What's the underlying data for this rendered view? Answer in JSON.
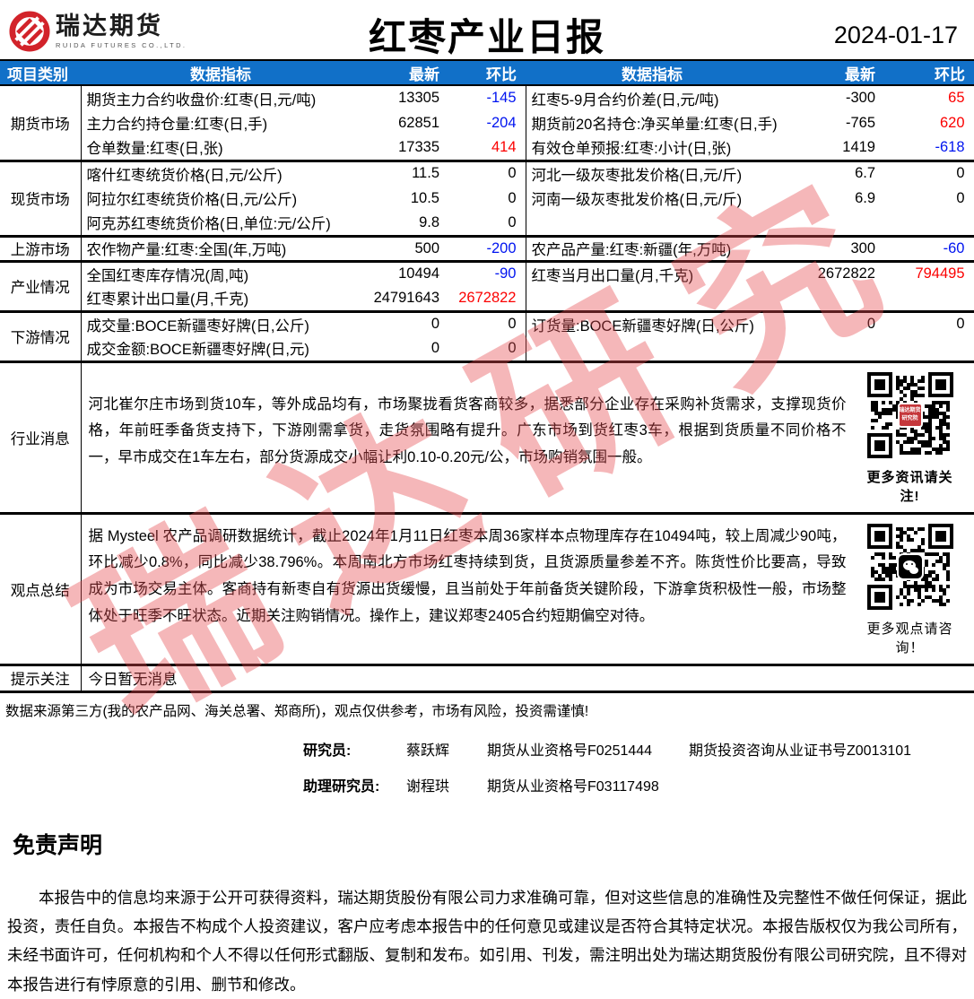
{
  "header": {
    "logo_cn": "瑞达期货",
    "logo_en": "RUIDA FUTURES CO.,LTD.",
    "title": "红枣产业日报",
    "date": "2024-01-17"
  },
  "colors": {
    "header_bg": "#1170c8",
    "up_red": "#fb0000",
    "down_blue": "#0014f0",
    "watermark_red": "#e74b4f",
    "logo_red": "#d2232a"
  },
  "watermark": "瑞达研究",
  "table": {
    "columns": [
      "项目类别",
      "数据指标",
      "最新",
      "环比",
      "数据指标",
      "最新",
      "环比"
    ],
    "sections": [
      {
        "category": "期货市场",
        "rows": [
          {
            "l_label": "期货主力合约收盘价:红枣(日,元/吨)",
            "l_latest": "13305",
            "l_delta": "-145",
            "l_trend": "down",
            "r_label": "红枣5-9月合约价差(日,元/吨)",
            "r_latest": "-300",
            "r_delta": "65",
            "r_trend": "up"
          },
          {
            "l_label": "主力合约持仓量:红枣(日,手)",
            "l_latest": "62851",
            "l_delta": "-204",
            "l_trend": "down",
            "r_label": "期货前20名持仓:净买单量:红枣(日,手)",
            "r_latest": "-765",
            "r_delta": "620",
            "r_trend": "up"
          },
          {
            "l_label": "仓单数量:红枣(日,张)",
            "l_latest": "17335",
            "l_delta": "414",
            "l_trend": "up",
            "r_label": "有效仓单预报:红枣:小计(日,张)",
            "r_latest": "1419",
            "r_delta": "-618",
            "r_trend": "down"
          }
        ]
      },
      {
        "category": "现货市场",
        "rows": [
          {
            "l_label": "喀什红枣统货价格(日,元/公斤)",
            "l_latest": "11.5",
            "l_delta": "0",
            "l_trend": "",
            "r_label": "河北一级灰枣批发价格(日,元/斤)",
            "r_latest": "6.7",
            "r_delta": "0",
            "r_trend": ""
          },
          {
            "l_label": "阿拉尔红枣统货价格(日,元/公斤)",
            "l_latest": "10.5",
            "l_delta": "0",
            "l_trend": "",
            "r_label": "河南一级灰枣批发价格(日,元/斤)",
            "r_latest": "6.9",
            "r_delta": "0",
            "r_trend": ""
          },
          {
            "l_label": "阿克苏红枣统货价格(日,单位:元/公斤)",
            "l_latest": "9.8",
            "l_delta": "0",
            "l_trend": "",
            "r_label": "",
            "r_latest": "",
            "r_delta": "",
            "r_trend": ""
          }
        ]
      },
      {
        "category": "上游市场",
        "rows": [
          {
            "l_label": "农作物产量:红枣:全国(年,万吨)",
            "l_latest": "500",
            "l_delta": "-200",
            "l_trend": "down",
            "r_label": "农产品产量:红枣:新疆(年,万吨)",
            "r_latest": "300",
            "r_delta": "-60",
            "r_trend": "down"
          }
        ]
      },
      {
        "category": "产业情况",
        "rows": [
          {
            "l_label": "全国红枣库存情况(周,吨)",
            "l_latest": "10494",
            "l_delta": "-90",
            "l_trend": "down",
            "r_label": "红枣当月出口量(月,千克)",
            "r_latest": "2672822",
            "r_delta": "794495",
            "r_trend": "up"
          },
          {
            "l_label": "红枣累计出口量(月,千克)",
            "l_latest": "24791643",
            "l_delta": "2672822",
            "l_trend": "up",
            "r_label": "",
            "r_latest": "",
            "r_delta": "",
            "r_trend": ""
          }
        ]
      },
      {
        "category": "下游情况",
        "rows": [
          {
            "l_label": "成交量:BOCE新疆枣好牌(日,公斤)",
            "l_latest": "0",
            "l_delta": "0",
            "l_trend": "",
            "r_label": "订货量:BOCE新疆枣好牌(日,公斤)",
            "r_latest": "0",
            "r_delta": "0",
            "r_trend": ""
          },
          {
            "l_label": "成交金额:BOCE新疆枣好牌(日,元)",
            "l_latest": "0",
            "l_delta": "0",
            "l_trend": "",
            "r_label": "",
            "r_latest": "",
            "r_delta": "",
            "r_trend": ""
          }
        ]
      }
    ],
    "news": {
      "category": "行业消息",
      "text": "河北崔尔庄市场到货10车，等外成品均有，市场聚拢看货客商较多，据悉部分企业存在采购补货需求，支撑现货价格，年前旺季备货支持下，下游刚需拿货，走货氛围略有提升。广东市场到货红枣3车，根据到货质量不同价格不一，早市成交在1车左右，部分货源成交小幅让利0.10-0.20元/公，市场购销氛围一般。",
      "qr_badge": "瑞达期货研究院",
      "qr_caption": "更多资讯请关注!"
    },
    "summary": {
      "category": "观点总结",
      "text": "据 Mysteel 农产品调研数据统计，截止2024年1月11日红枣本周36家样本点物理库存在10494吨，较上周减少90吨，环比减少0.8%，同比减少38.796%。本周南北方市场红枣持续到货，且货源质量参差不齐。陈货性价比要高，导致成为市场交易主体。客商持有新枣自有货源出货缓慢，且当前处于年前备货关键阶段，下游拿货积极性一般，市场整体处于旺季不旺状态。近期关注购销情况。操作上，建议郑枣2405合约短期偏空对待。",
      "qr_caption": "更多观点请咨询！"
    },
    "notice": {
      "category": "提示关注",
      "text": "今日暂无消息"
    }
  },
  "footer": {
    "source_note": "数据来源第三方(我的农产品网、海关总署、郑商所)，观点仅供参考，市场有风险，投资需谨慎!",
    "researcher": {
      "label": "研究员:",
      "name": "蔡跃辉",
      "cert1": "期货从业资格号F0251444",
      "cert2": "期货投资咨询从业证书号Z0013101"
    },
    "assistant": {
      "label": "助理研究员:",
      "name": "谢程珙",
      "cert1": "期货从业资格号F03117498"
    },
    "disclaimer_title": "免责声明",
    "disclaimer_text": "本报告中的信息均来源于公开可获得资料，瑞达期货股份有限公司力求准确可靠，但对这些信息的准确性及完整性不做任何保证，据此投资，责任自负。本报告不构成个人投资建议，客户应考虑本报告中的任何意见或建议是否符合其特定状况。本报告版权仅为我公司所有，未经书面许可，任何机构和个人不得以任何形式翻版、复制和发布。如引用、刊发，需注明出处为瑞达期货股份有限公司研究院，且不得对本报告进行有悖原意的引用、删节和修改。"
  }
}
